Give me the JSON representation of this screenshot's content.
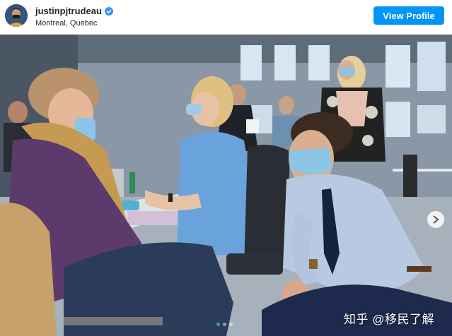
{
  "post": {
    "username": "justinpjtrudeau",
    "location": "Montreal, Quebec",
    "view_profile_label": "View Profile",
    "verified_icon": "verified-check-icon"
  },
  "carousel": {
    "slide_count": 3,
    "active_index": 0
  },
  "watermark": {
    "text": "知乎 @移民了解"
  },
  "colors": {
    "button_blue": "#0095f6",
    "verified_blue": "#3897f0"
  }
}
